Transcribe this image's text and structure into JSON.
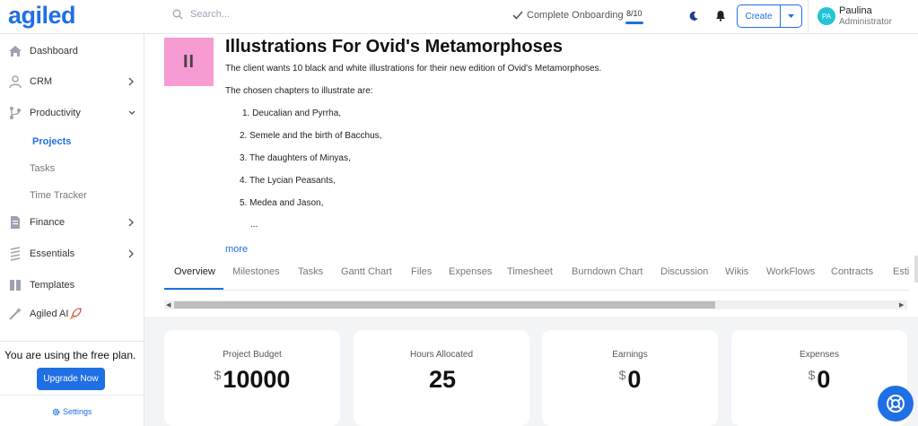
{
  "app": {
    "logo_text": "agiled",
    "brand_color": "#1f6fe5"
  },
  "header": {
    "search_placeholder": "Search...",
    "onboarding_label": "Complete Onboarding",
    "onboarding_count": "8/10",
    "onboarding_progress": 0.8,
    "create_label": "Create",
    "user": {
      "initials": "PA",
      "name": "Paulina",
      "role": "Administrator"
    }
  },
  "sidebar": {
    "items": [
      {
        "label": "Dashboard"
      },
      {
        "label": "CRM"
      },
      {
        "label": "Productivity"
      },
      {
        "label": "Finance"
      },
      {
        "label": "Essentials"
      },
      {
        "label": "Templates"
      },
      {
        "label": "Agiled AI"
      }
    ],
    "productivity_sub": [
      {
        "label": "Projects"
      },
      {
        "label": "Tasks"
      },
      {
        "label": "Time Tracker"
      }
    ],
    "plan_text": "You are using the free plan.",
    "upgrade_label": "Upgrade Now",
    "settings_label": "Settings"
  },
  "project": {
    "thumb_initials": "II",
    "title": "Illustrations For Ovid's Metamorphoses",
    "description": "The client wants 10 black and white illustrations for their new edition of Ovid's Metamorphoses.",
    "chapters_intro": "The chosen chapters to illustrate are:",
    "chapters": [
      "1. Deucalian and Pyrrha,",
      "2. Semele and the birth of Bacchus,",
      "3. The daughters of Minyas,",
      "4. The Lycian Peasants,",
      "5. Medea and Jason,",
      "..."
    ],
    "more_label": "more"
  },
  "tabs": [
    "Overview",
    "Milestones",
    "Tasks",
    "Gantt Chart",
    "Files",
    "Expenses",
    "Timesheet",
    "Burndown Chart",
    "Discussion",
    "Wikis",
    "WorkFlows",
    "Contracts",
    "Esti"
  ],
  "stats": [
    {
      "label": "Project Budget",
      "currency": "$",
      "value": "10000"
    },
    {
      "label": "Hours Allocated",
      "currency": "",
      "value": "25"
    },
    {
      "label": "Earnings",
      "currency": "$",
      "value": "0"
    },
    {
      "label": "Expenses",
      "currency": "$",
      "value": "0"
    }
  ]
}
